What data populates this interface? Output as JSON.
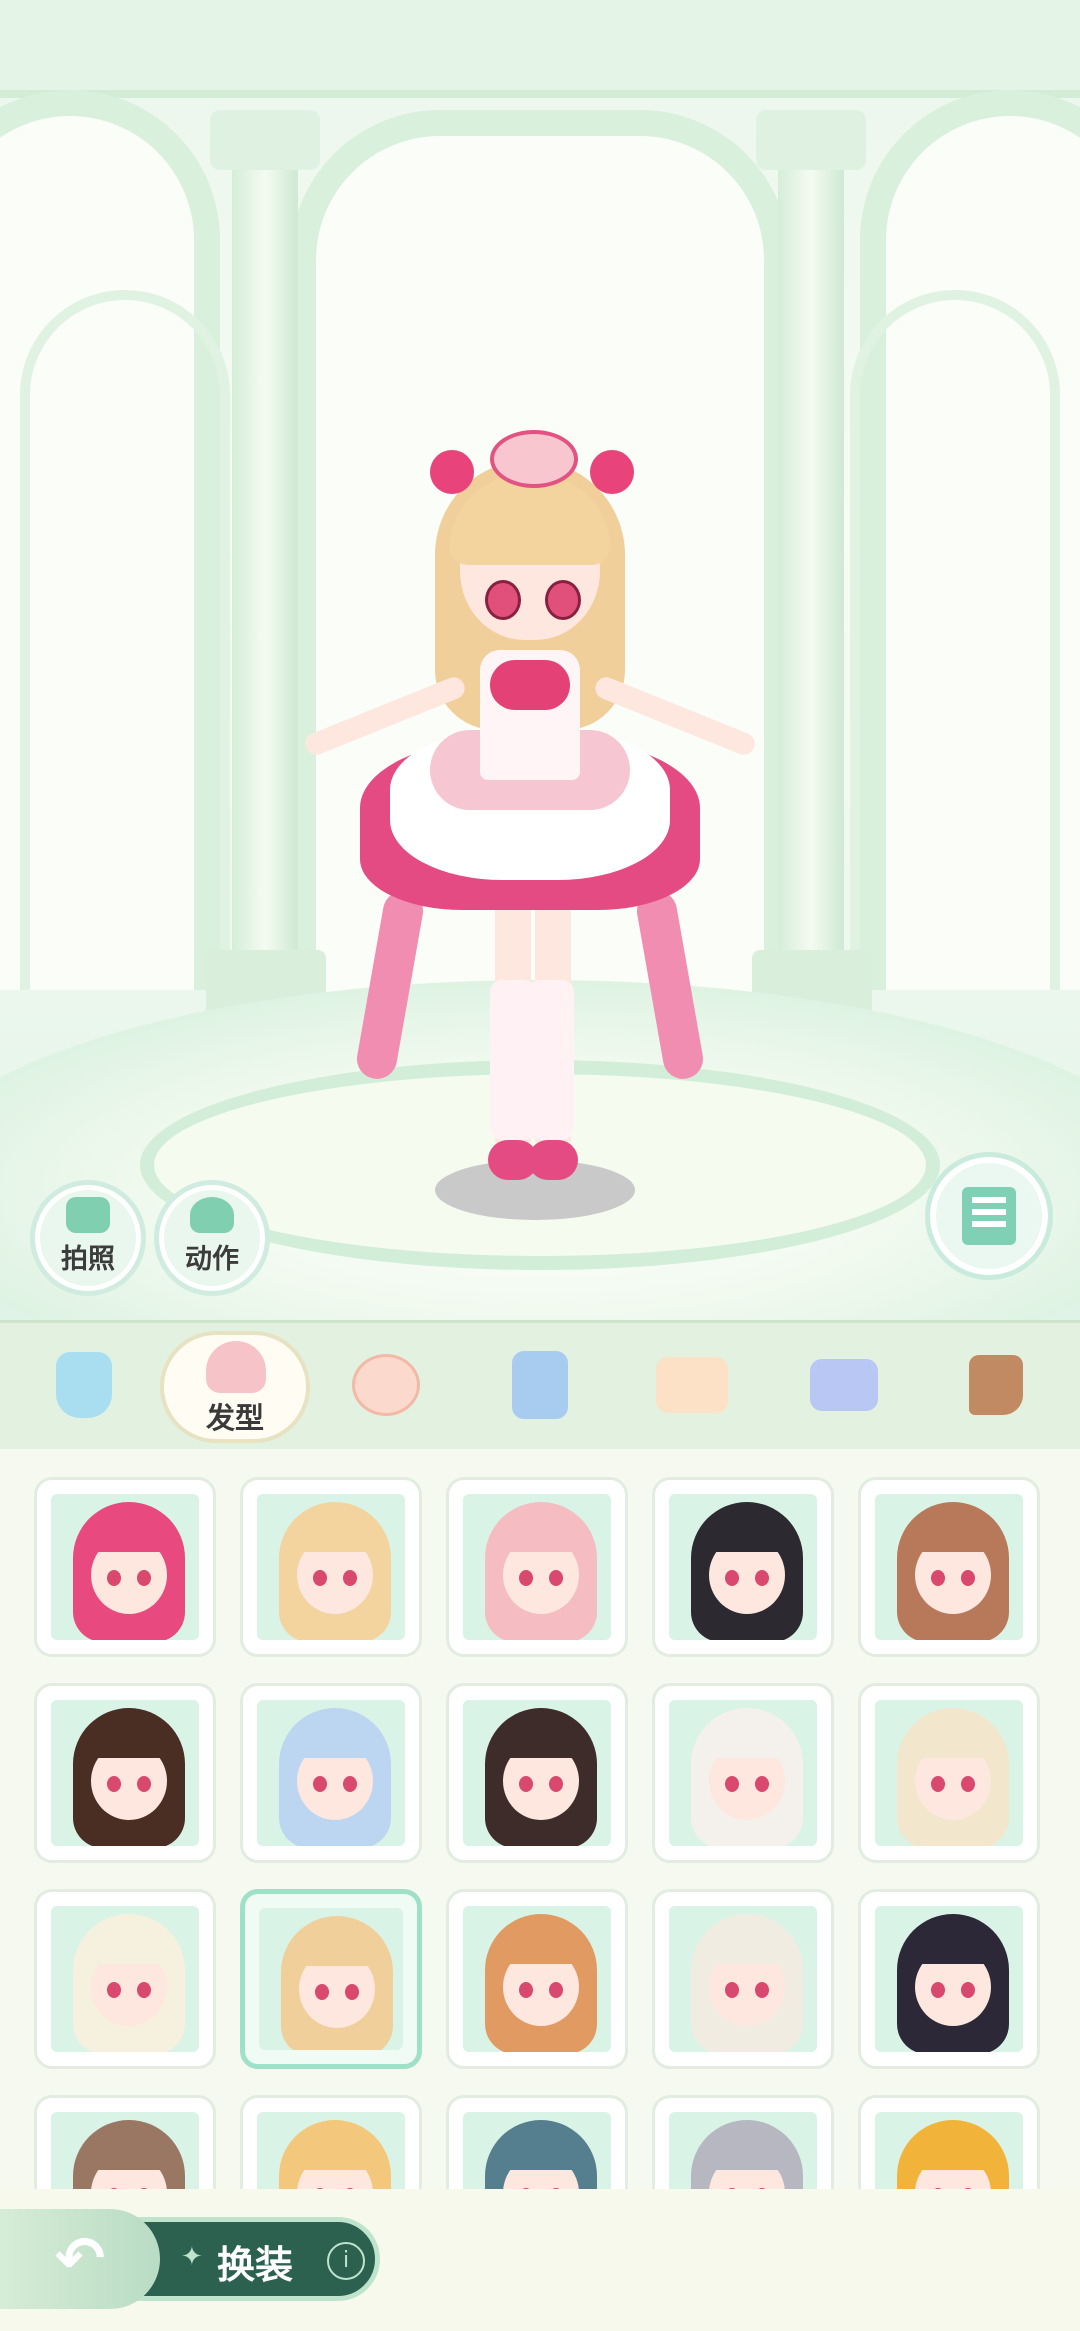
{
  "stage": {
    "photo_label": "拍照",
    "action_label": "动作"
  },
  "categories": [
    {
      "id": "dress",
      "icon": "dress-icon",
      "color": "#a9def0"
    },
    {
      "id": "hair",
      "icon": "hairstyle-icon",
      "label": "发型",
      "selected": true,
      "color": "#f6c4c8"
    },
    {
      "id": "face",
      "icon": "face-icon",
      "color": "#fbd9cd"
    },
    {
      "id": "top",
      "icon": "overalls-icon",
      "color": "#a8cbf0"
    },
    {
      "id": "shirt",
      "icon": "tshirt-icon",
      "color": "#fce1c6"
    },
    {
      "id": "bottom",
      "icon": "shorts-icon",
      "color": "#b8c7f4"
    },
    {
      "id": "shoes",
      "icon": "boot-icon",
      "color": "#c18a62"
    }
  ],
  "hairstyles": [
    {
      "color": "#e8497e"
    },
    {
      "color": "#f3d39e"
    },
    {
      "color": "#f5bcc2"
    },
    {
      "color": "#2c2a30"
    },
    {
      "color": "#b8795a"
    },
    {
      "color": "#4a2e24"
    },
    {
      "color": "#bcd6f2"
    },
    {
      "color": "#3d2c2a"
    },
    {
      "color": "#f4f1ec"
    },
    {
      "color": "#f2e6cc"
    },
    {
      "color": "#f6f0de"
    },
    {
      "color": "#f0cf9a",
      "selected": true
    },
    {
      "color": "#e09a62"
    },
    {
      "color": "#f1ece2"
    },
    {
      "color": "#2c2838"
    },
    {
      "color": "#9a7762"
    },
    {
      "color": "#f3c77c"
    },
    {
      "color": "#557f8e"
    },
    {
      "color": "#b6b7c0"
    },
    {
      "color": "#f2b33a"
    }
  ],
  "bottom_bar": {
    "mode_label": "换装",
    "info_label": "i"
  }
}
